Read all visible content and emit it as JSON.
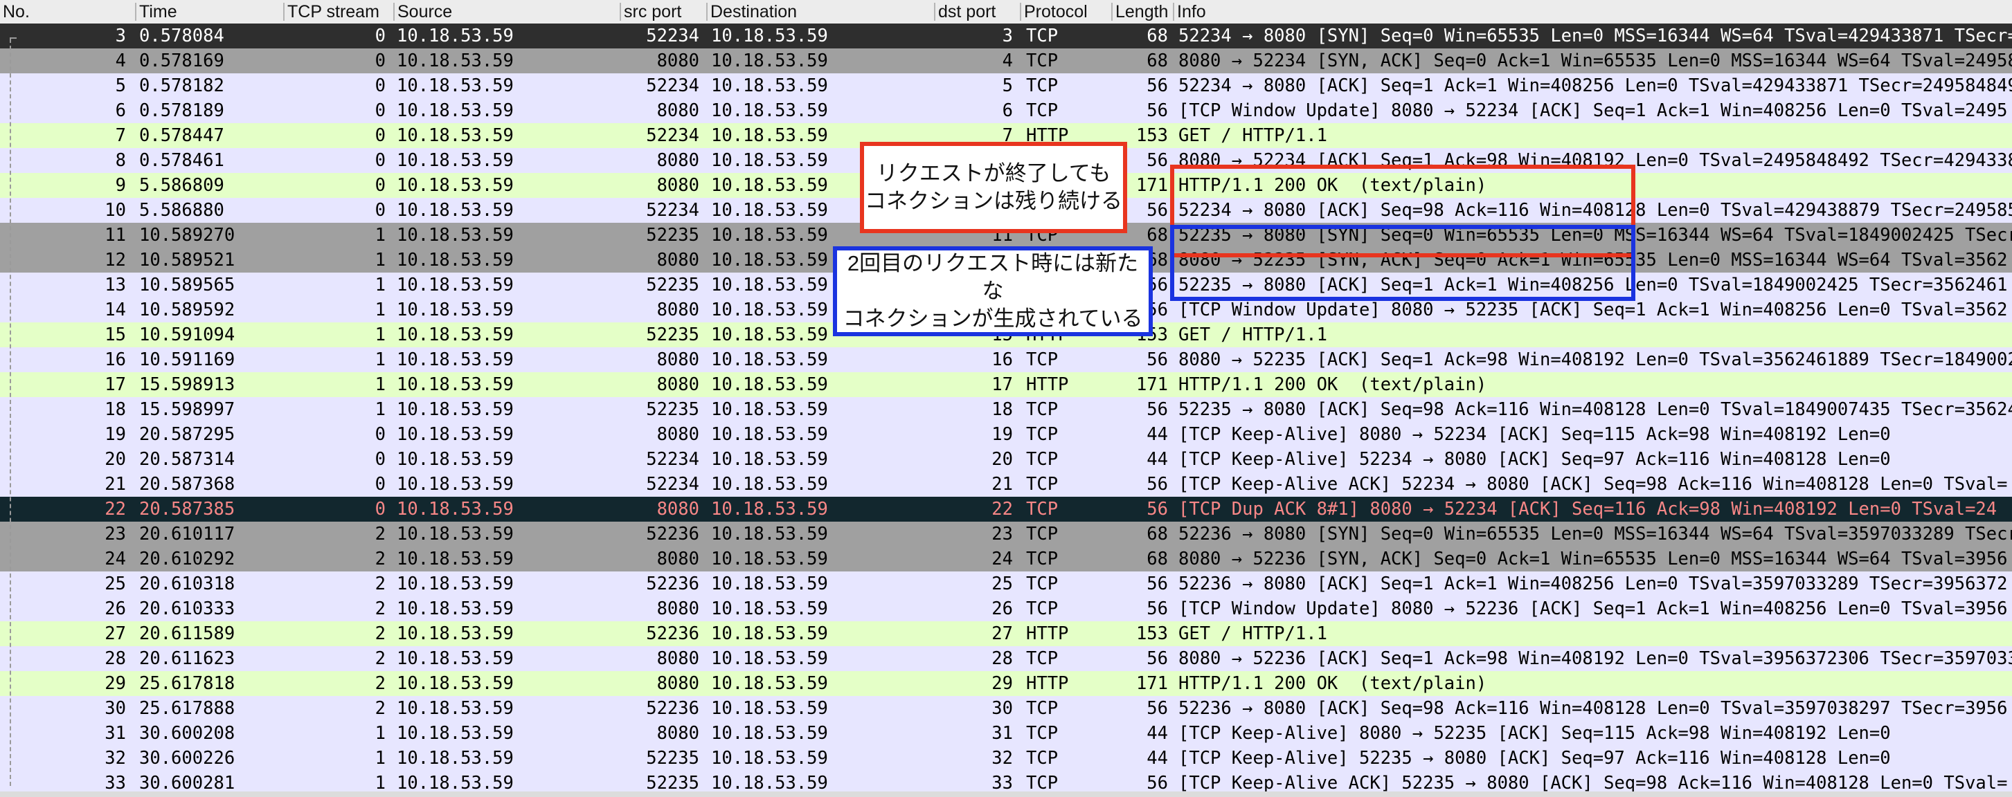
{
  "columns": [
    "No.",
    "Time",
    "TCP stream",
    "Source",
    "src port",
    "Destination",
    "dst port",
    "Protocol",
    "Length",
    "Info"
  ],
  "rows": [
    {
      "no": "3",
      "time": "0.578084",
      "stream": "0",
      "src": "10.18.53.59",
      "sport": "52234",
      "dst": "10.18.53.59",
      "dport": "3",
      "proto": "TCP",
      "len": "68",
      "info": "52234 → 8080 [SYN] Seq=0 Win=65535 Len=0 MSS=16344 WS=64 TSval=429433871 TSecr=0",
      "style": "first"
    },
    {
      "no": "4",
      "time": "0.578169",
      "stream": "0",
      "src": "10.18.53.59",
      "sport": "8080",
      "dst": "10.18.53.59",
      "dport": "4",
      "proto": "TCP",
      "len": "68",
      "info": "8080 → 52234 [SYN, ACK] Seq=0 Ack=1 Win=65535 Len=0 MSS=16344 WS=64 TSval=2495848",
      "style": "syn"
    },
    {
      "no": "5",
      "time": "0.578182",
      "stream": "0",
      "src": "10.18.53.59",
      "sport": "52234",
      "dst": "10.18.53.59",
      "dport": "5",
      "proto": "TCP",
      "len": "56",
      "info": "52234 → 8080 [ACK] Seq=1 Ack=1 Win=408256 Len=0 TSval=429433871 TSecr=2495848492",
      "style": "tcp"
    },
    {
      "no": "6",
      "time": "0.578189",
      "stream": "0",
      "src": "10.18.53.59",
      "sport": "8080",
      "dst": "10.18.53.59",
      "dport": "6",
      "proto": "TCP",
      "len": "56",
      "info": "[TCP Window Update] 8080 → 52234 [ACK] Seq=1 Ack=1 Win=408256 Len=0 TSval=2495",
      "style": "tcp"
    },
    {
      "no": "7",
      "time": "0.578447",
      "stream": "0",
      "src": "10.18.53.59",
      "sport": "52234",
      "dst": "10.18.53.59",
      "dport": "7",
      "proto": "HTTP",
      "len": "153",
      "info": "GET / HTTP/1.1",
      "style": "http"
    },
    {
      "no": "8",
      "time": "0.578461",
      "stream": "0",
      "src": "10.18.53.59",
      "sport": "8080",
      "dst": "10.18.53.59",
      "dport": "8",
      "proto": "TCP",
      "len": "56",
      "info": "8080 → 52234 [ACK] Seq=1 Ack=98 Win=408192 Len=0 TSval=2495848492 TSecr=429433871",
      "style": "tcp"
    },
    {
      "no": "9",
      "time": "5.586809",
      "stream": "0",
      "src": "10.18.53.59",
      "sport": "8080",
      "dst": "10.18.53.59",
      "dport": "9",
      "proto": "HTTP",
      "len": "171",
      "info": "HTTP/1.1 200 OK  (text/plain)",
      "style": "http"
    },
    {
      "no": "10",
      "time": "5.586880",
      "stream": "0",
      "src": "10.18.53.59",
      "sport": "52234",
      "dst": "10.18.53.59",
      "dport": "10",
      "proto": "TCP",
      "len": "56",
      "info": "52234 → 8080 [ACK] Seq=98 Ack=116 Win=408128 Len=0 TSval=429438879 TSecr=2495853",
      "style": "tcp"
    },
    {
      "no": "11",
      "time": "10.589270",
      "stream": "1",
      "src": "10.18.53.59",
      "sport": "52235",
      "dst": "10.18.53.59",
      "dport": "11",
      "proto": "TCP",
      "len": "68",
      "info": "52235 → 8080 [SYN] Seq=0 Win=65535 Len=0 MSS=16344 WS=64 TSval=1849002425 TSecr=0",
      "style": "syn"
    },
    {
      "no": "12",
      "time": "10.589521",
      "stream": "1",
      "src": "10.18.53.59",
      "sport": "8080",
      "dst": "10.18.53.59",
      "dport": "12",
      "proto": "TCP",
      "len": "68",
      "info": "8080 → 52235 [SYN, ACK] Seq=0 Ack=1 Win=65535 Len=0 MSS=16344 WS=64 TSval=3562",
      "style": "syn"
    },
    {
      "no": "13",
      "time": "10.589565",
      "stream": "1",
      "src": "10.18.53.59",
      "sport": "52235",
      "dst": "10.18.53.59",
      "dport": "13",
      "proto": "TCP",
      "len": "56",
      "info": "52235 → 8080 [ACK] Seq=1 Ack=1 Win=408256 Len=0 TSval=1849002425 TSecr=3562461",
      "style": "tcp"
    },
    {
      "no": "14",
      "time": "10.589592",
      "stream": "1",
      "src": "10.18.53.59",
      "sport": "8080",
      "dst": "10.18.53.59",
      "dport": "14",
      "proto": "TCP",
      "len": "56",
      "info": "[TCP Window Update] 8080 → 52235 [ACK] Seq=1 Ack=1 Win=408256 Len=0 TSval=3562",
      "style": "tcp"
    },
    {
      "no": "15",
      "time": "10.591094",
      "stream": "1",
      "src": "10.18.53.59",
      "sport": "52235",
      "dst": "10.18.53.59",
      "dport": "15",
      "proto": "HTTP",
      "len": "153",
      "info": "GET / HTTP/1.1",
      "style": "http"
    },
    {
      "no": "16",
      "time": "10.591169",
      "stream": "1",
      "src": "10.18.53.59",
      "sport": "8080",
      "dst": "10.18.53.59",
      "dport": "16",
      "proto": "TCP",
      "len": "56",
      "info": "8080 → 52235 [ACK] Seq=1 Ack=98 Win=408192 Len=0 TSval=3562461889 TSecr=1849002",
      "style": "tcp"
    },
    {
      "no": "17",
      "time": "15.598913",
      "stream": "1",
      "src": "10.18.53.59",
      "sport": "8080",
      "dst": "10.18.53.59",
      "dport": "17",
      "proto": "HTTP",
      "len": "171",
      "info": "HTTP/1.1 200 OK  (text/plain)",
      "style": "http"
    },
    {
      "no": "18",
      "time": "15.598997",
      "stream": "1",
      "src": "10.18.53.59",
      "sport": "52235",
      "dst": "10.18.53.59",
      "dport": "18",
      "proto": "TCP",
      "len": "56",
      "info": "52235 → 8080 [ACK] Seq=98 Ack=116 Win=408128 Len=0 TSval=1849007435 TSecr=3562466",
      "style": "tcp"
    },
    {
      "no": "19",
      "time": "20.587295",
      "stream": "0",
      "src": "10.18.53.59",
      "sport": "8080",
      "dst": "10.18.53.59",
      "dport": "19",
      "proto": "TCP",
      "len": "44",
      "info": "[TCP Keep-Alive] 8080 → 52234 [ACK] Seq=115 Ack=98 Win=408192 Len=0",
      "style": "tcp"
    },
    {
      "no": "20",
      "time": "20.587314",
      "stream": "0",
      "src": "10.18.53.59",
      "sport": "52234",
      "dst": "10.18.53.59",
      "dport": "20",
      "proto": "TCP",
      "len": "44",
      "info": "[TCP Keep-Alive] 52234 → 8080 [ACK] Seq=97 Ack=116 Win=408128 Len=0",
      "style": "tcp"
    },
    {
      "no": "21",
      "time": "20.587368",
      "stream": "0",
      "src": "10.18.53.59",
      "sport": "52234",
      "dst": "10.18.53.59",
      "dport": "21",
      "proto": "TCP",
      "len": "56",
      "info": "[TCP Keep-Alive ACK] 52234 → 8080 [ACK] Seq=98 Ack=116 Win=408128 Len=0 TSval=",
      "style": "tcp"
    },
    {
      "no": "22",
      "time": "20.587385",
      "stream": "0",
      "src": "10.18.53.59",
      "sport": "8080",
      "dst": "10.18.53.59",
      "dport": "22",
      "proto": "TCP",
      "len": "56",
      "info": "[TCP Dup ACK 8#1] 8080 → 52234 [ACK] Seq=116 Ack=98 Win=408192 Len=0 TSval=24",
      "style": "bad"
    },
    {
      "no": "23",
      "time": "20.610117",
      "stream": "2",
      "src": "10.18.53.59",
      "sport": "52236",
      "dst": "10.18.53.59",
      "dport": "23",
      "proto": "TCP",
      "len": "68",
      "info": "52236 → 8080 [SYN] Seq=0 Win=65535 Len=0 MSS=16344 WS=64 TSval=3597033289 TSecr=0",
      "style": "syn"
    },
    {
      "no": "24",
      "time": "20.610292",
      "stream": "2",
      "src": "10.18.53.59",
      "sport": "8080",
      "dst": "10.18.53.59",
      "dport": "24",
      "proto": "TCP",
      "len": "68",
      "info": "8080 → 52236 [SYN, ACK] Seq=0 Ack=1 Win=65535 Len=0 MSS=16344 WS=64 TSval=3956",
      "style": "syn"
    },
    {
      "no": "25",
      "time": "20.610318",
      "stream": "2",
      "src": "10.18.53.59",
      "sport": "52236",
      "dst": "10.18.53.59",
      "dport": "25",
      "proto": "TCP",
      "len": "56",
      "info": "52236 → 8080 [ACK] Seq=1 Ack=1 Win=408256 Len=0 TSval=3597033289 TSecr=3956372",
      "style": "tcp"
    },
    {
      "no": "26",
      "time": "20.610333",
      "stream": "2",
      "src": "10.18.53.59",
      "sport": "8080",
      "dst": "10.18.53.59",
      "dport": "26",
      "proto": "TCP",
      "len": "56",
      "info": "[TCP Window Update] 8080 → 52236 [ACK] Seq=1 Ack=1 Win=408256 Len=0 TSval=3956",
      "style": "tcp"
    },
    {
      "no": "27",
      "time": "20.611589",
      "stream": "2",
      "src": "10.18.53.59",
      "sport": "52236",
      "dst": "10.18.53.59",
      "dport": "27",
      "proto": "HTTP",
      "len": "153",
      "info": "GET / HTTP/1.1",
      "style": "http"
    },
    {
      "no": "28",
      "time": "20.611623",
      "stream": "2",
      "src": "10.18.53.59",
      "sport": "8080",
      "dst": "10.18.53.59",
      "dport": "28",
      "proto": "TCP",
      "len": "56",
      "info": "8080 → 52236 [ACK] Seq=1 Ack=98 Win=408192 Len=0 TSval=3956372306 TSecr=3597033",
      "style": "tcp"
    },
    {
      "no": "29",
      "time": "25.617818",
      "stream": "2",
      "src": "10.18.53.59",
      "sport": "8080",
      "dst": "10.18.53.59",
      "dport": "29",
      "proto": "HTTP",
      "len": "171",
      "info": "HTTP/1.1 200 OK  (text/plain)",
      "style": "http"
    },
    {
      "no": "30",
      "time": "25.617888",
      "stream": "2",
      "src": "10.18.53.59",
      "sport": "52236",
      "dst": "10.18.53.59",
      "dport": "30",
      "proto": "TCP",
      "len": "56",
      "info": "52236 → 8080 [ACK] Seq=98 Ack=116 Win=408128 Len=0 TSval=3597038297 TSecr=3956",
      "style": "tcp"
    },
    {
      "no": "31",
      "time": "30.600208",
      "stream": "1",
      "src": "10.18.53.59",
      "sport": "8080",
      "dst": "10.18.53.59",
      "dport": "31",
      "proto": "TCP",
      "len": "44",
      "info": "[TCP Keep-Alive] 8080 → 52235 [ACK] Seq=115 Ack=98 Win=408192 Len=0",
      "style": "tcp"
    },
    {
      "no": "32",
      "time": "30.600226",
      "stream": "1",
      "src": "10.18.53.59",
      "sport": "52235",
      "dst": "10.18.53.59",
      "dport": "32",
      "proto": "TCP",
      "len": "44",
      "info": "[TCP Keep-Alive] 52235 → 8080 [ACK] Seq=97 Ack=116 Win=408128 Len=0",
      "style": "tcp"
    },
    {
      "no": "33",
      "time": "30.600281",
      "stream": "1",
      "src": "10.18.53.59",
      "sport": "52235",
      "dst": "10.18.53.59",
      "dport": "33",
      "proto": "TCP",
      "len": "56",
      "info": "[TCP Keep-Alive ACK] 52235 → 8080 [ACK] Seq=98 Ack=116 Win=408128 Len=0 TSval=",
      "style": "tcp"
    }
  ],
  "annotations": [
    {
      "text": "リクエストが終了しても\nコネクションは残り続ける",
      "color": "#e8351f"
    },
    {
      "text": "2回目のリクエスト時には新たな\nコネクションが生成されている",
      "color": "#1a33e0"
    }
  ],
  "colors": {
    "tcp_row": "#e7e6ff",
    "http_row": "#e4ffc7",
    "syn_row": "#a0a0a0",
    "first_row": "#2e2e2e",
    "bad_row": "#12272e",
    "bad_text": "#f78787"
  }
}
